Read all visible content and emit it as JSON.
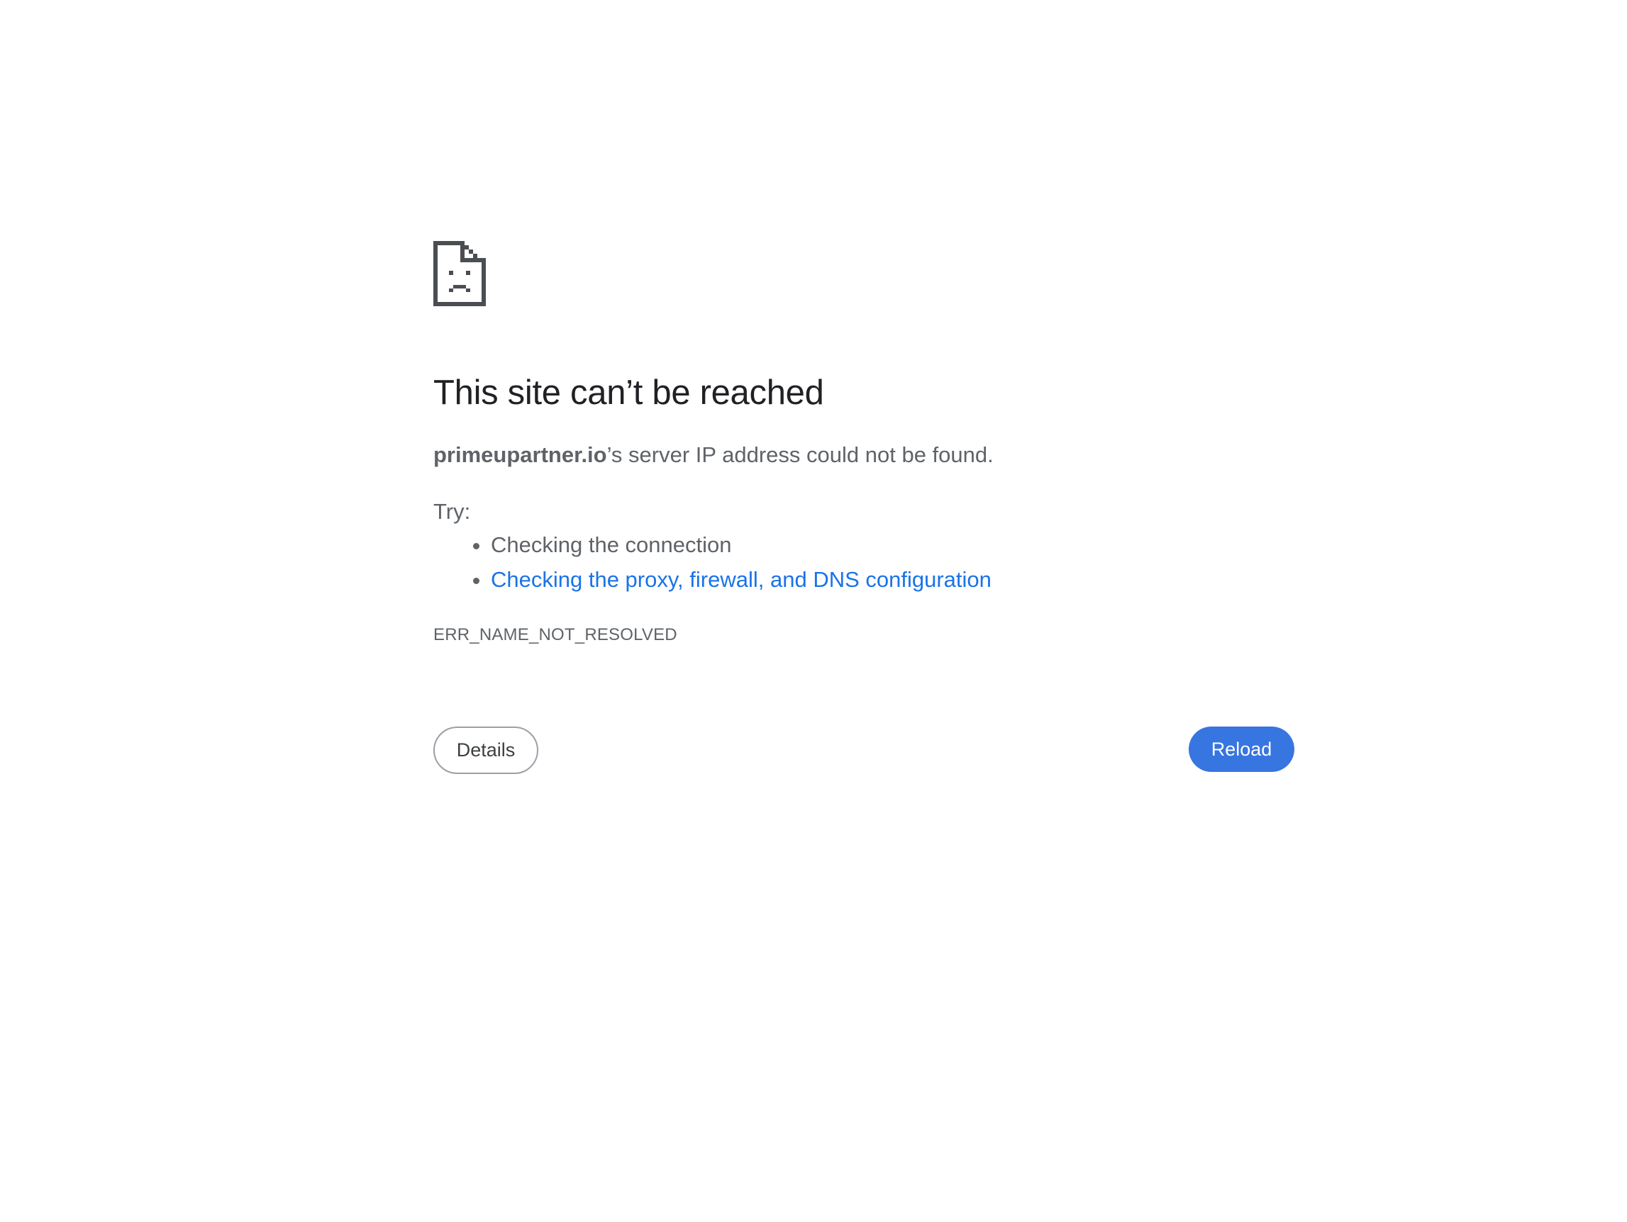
{
  "icon": {
    "name": "sad-document-icon",
    "color": "#5f6368"
  },
  "error": {
    "title": "This site can’t be reached",
    "host": "primeupartner.io",
    "summary_suffix": "’s server IP address could not be found.",
    "try_label": "Try:",
    "suggestions": [
      {
        "label": "Checking the connection",
        "is_link": false
      },
      {
        "label": "Checking the proxy, firewall, and DNS configuration",
        "is_link": true
      }
    ],
    "code": "ERR_NAME_NOT_RESOLVED"
  },
  "buttons": {
    "details_label": "Details",
    "reload_label": "Reload"
  },
  "colors": {
    "title": "#202124",
    "body_text": "#5f6368",
    "link": "#1a73e8",
    "reload_button": "#3775e0"
  }
}
